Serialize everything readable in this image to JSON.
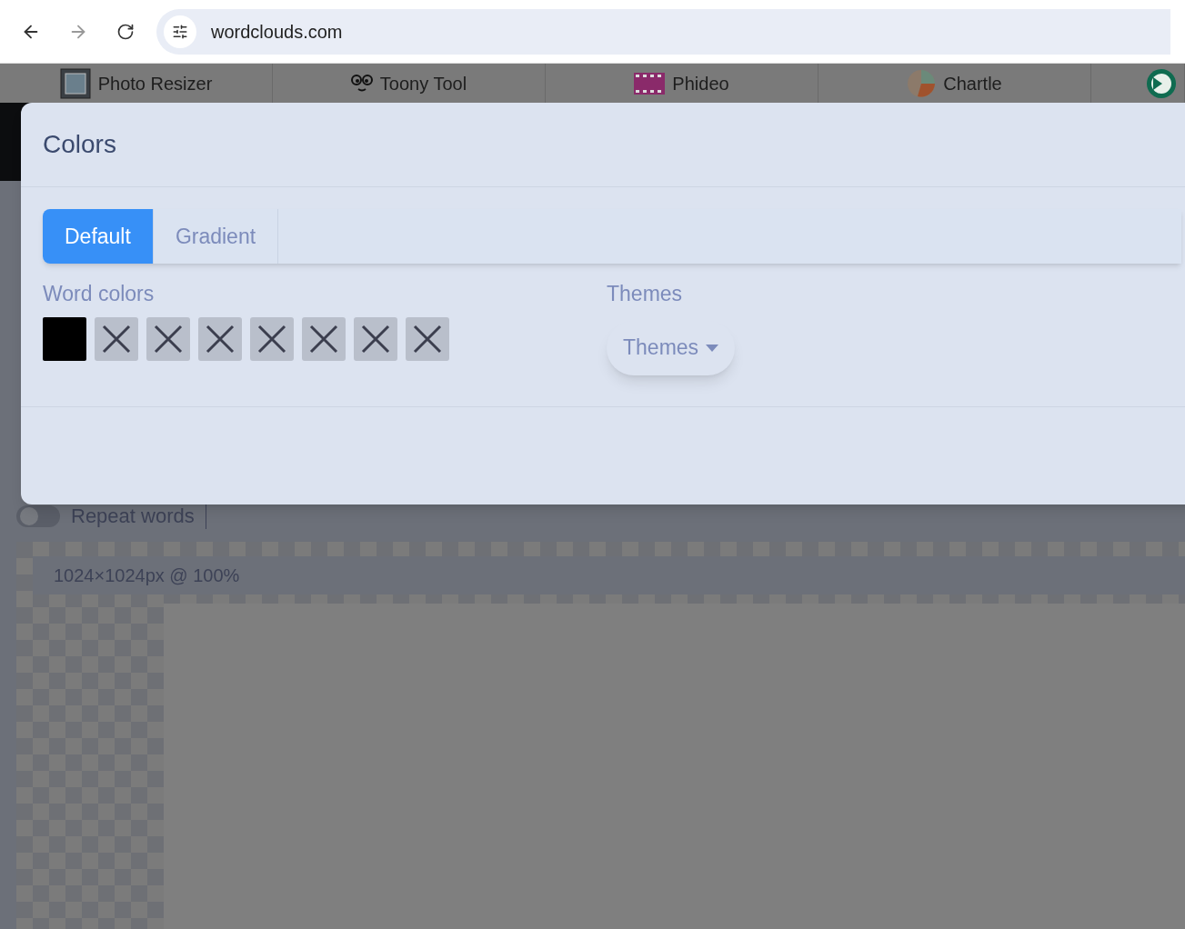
{
  "browser": {
    "url": "wordclouds.com"
  },
  "bookmarks": [
    {
      "label": "Photo Resizer",
      "kind": "frame"
    },
    {
      "label": "Toony Tool",
      "kind": "face"
    },
    {
      "label": "Phideo",
      "kind": "film"
    },
    {
      "label": "Chartle",
      "kind": "pie"
    },
    {
      "kind": "app"
    }
  ],
  "background": {
    "toggle_label": "Repeat words",
    "toggle_on": false,
    "canvas_size": "1024×1024px @ 100%"
  },
  "modal": {
    "title": "Colors",
    "tabs": [
      {
        "label": "Default",
        "selected": true
      },
      {
        "label": "Gradient",
        "selected": false
      }
    ],
    "word_colors_label": "Word colors",
    "swatches": [
      {
        "kind": "filled",
        "color": "#000000"
      },
      {
        "kind": "empty"
      },
      {
        "kind": "empty"
      },
      {
        "kind": "empty"
      },
      {
        "kind": "empty"
      },
      {
        "kind": "empty"
      },
      {
        "kind": "empty"
      },
      {
        "kind": "empty"
      }
    ],
    "themes_label": "Themes",
    "themes_button": "Themes"
  }
}
